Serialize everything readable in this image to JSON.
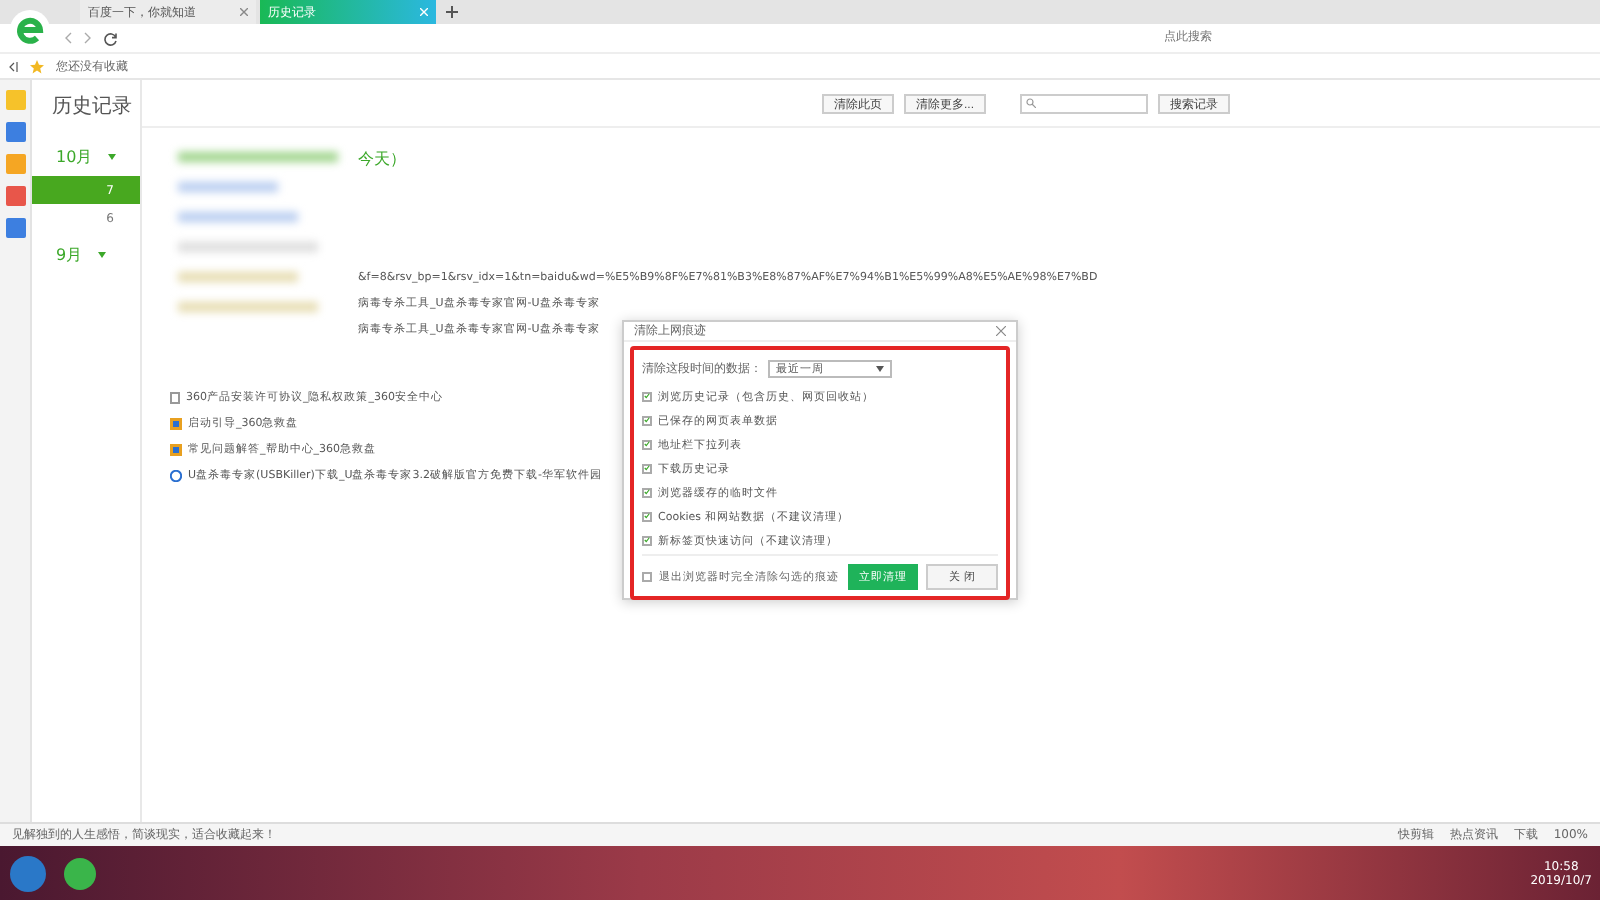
{
  "tabs": [
    {
      "label": "百度一下，你就知道",
      "selected": false
    },
    {
      "label": "历史记录",
      "selected": true
    }
  ],
  "address_bar": {
    "placeholder": "点此搜索"
  },
  "bookmarks_bar": {
    "text": "您还没有收藏"
  },
  "page_title": "历史记录",
  "toolbar": {
    "buttons": [
      "清除此页",
      "清除更多..."
    ],
    "search_button": "搜索记录"
  },
  "months": [
    {
      "label": "10月",
      "days": [
        {
          "label": "7",
          "selected": true
        },
        {
          "label": "6",
          "selected": false
        }
      ]
    },
    {
      "label": "9月"
    }
  ],
  "date_heading_tail": "今天）",
  "partial_rows": [
    "&f=8&rsv_bp=1&rsv_idx=1&tn=baidu&wd=%E5%B9%8F%E7%81%B3%E8%87%AF%E7%94%B1%E5%99%A8%E5%AE%98%E7%BD",
    "病毒专杀工具_U盘杀毒专家官网-U盘杀毒专家",
    "病毒专杀工具_U盘杀毒专家官网-U盘杀毒专家"
  ],
  "history": [
    {
      "kind": "doc",
      "title": "360产品安装许可协议_隐私权政策_360安全中心"
    },
    {
      "kind": "app",
      "title": "启动引导_360急救盘"
    },
    {
      "kind": "app",
      "title": "常见问题解答_帮助中心_360急救盘"
    },
    {
      "kind": "globe",
      "title": "U盘杀毒专家(USBKiller)下载_U盘杀毒专家3.2破解版官方免费下载-华军软件园"
    }
  ],
  "dialog": {
    "title": "清除上网痕迹",
    "range_label": "清除这段时间的数据：",
    "range_value": "最近一周",
    "options": [
      {
        "label": "浏览历史记录（包含历史、网页回收站）",
        "checked": true
      },
      {
        "label": "已保存的网页表单数据",
        "checked": true
      },
      {
        "label": "地址栏下拉列表",
        "checked": true
      },
      {
        "label": "下载历史记录",
        "checked": true
      },
      {
        "label": "浏览器缓存的临时文件",
        "checked": true
      },
      {
        "label": "Cookies 和网站数据（不建议清理）",
        "checked": true
      },
      {
        "label": "新标签页快速访问（不建议清理）",
        "checked": true
      }
    ],
    "exit_option": {
      "label": "退出浏览器时完全清除勾选的痕迹",
      "checked": false
    },
    "buttons": [
      "立即清理",
      "关 闭"
    ]
  },
  "status_bar": {
    "news": "见解独到的人生感悟，简谈现实，适合收藏起来！",
    "items": [
      "快剪辑",
      "热点资讯",
      "下载"
    ],
    "zoom": "100%"
  },
  "taskbar": {
    "time": "10:58",
    "date": "2019/10/7"
  }
}
